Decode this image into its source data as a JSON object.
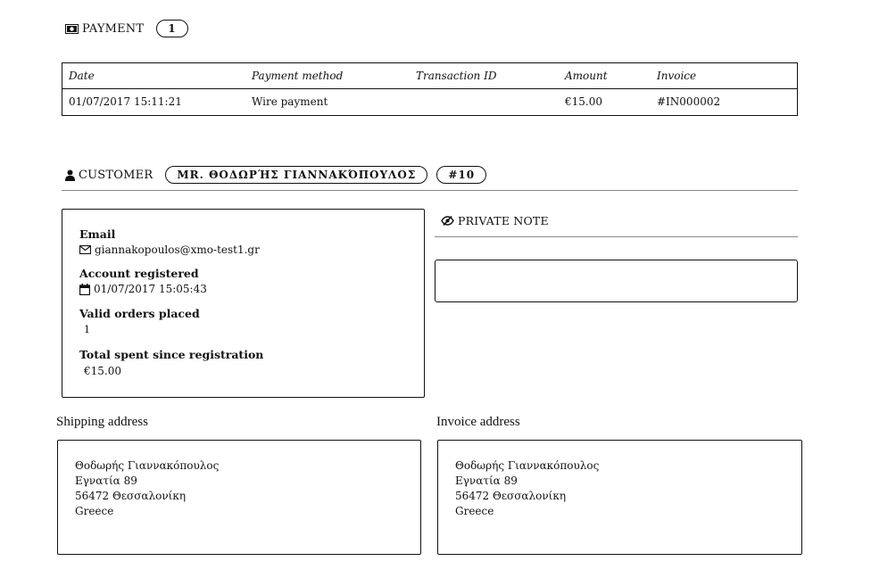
{
  "payment": {
    "title": "PAYMENT",
    "count": "1",
    "columns": [
      "Date",
      "Payment method",
      "Transaction ID",
      "Amount",
      "Invoice"
    ],
    "rows": [
      [
        "01/07/2017 15:11:21",
        "Wire payment",
        "",
        "€15.00",
        "#IN000002"
      ]
    ]
  },
  "customer": {
    "title": "CUSTOMER",
    "name": "MR. ΘΟΔΩΡΉΣ ΓΙΑΝΝΑΚΌΠΟΥΛΟΣ",
    "id": "#10",
    "email_label": "Email",
    "email": "giannakopoulos@xmo-test1.gr",
    "registered_label": "Account registered",
    "registered": "01/07/2017 15:05:43",
    "orders_label": "Valid orders placed",
    "orders": "1",
    "spent_label": "Total spent since registration",
    "spent": "€15.00"
  },
  "private_note": {
    "title": "PRIVATE NOTE",
    "value": ""
  },
  "shipping": {
    "title": "Shipping address",
    "lines": [
      "Θοδωρής Γιαννακόπουλος",
      "Εγνατία 89",
      "56472 Θεσσαλονίκη",
      "Greece"
    ]
  },
  "invoice_address": {
    "title": "Invoice address",
    "lines": [
      "Θοδωρής Γιαννακόπουλος",
      "Εγνατία 89",
      "56472 Θεσσαλονίκη",
      "Greece"
    ]
  },
  "icons": {
    "payment": "money-icon",
    "customer": "user-icon",
    "email": "envelope-icon",
    "calendar": "calendar-icon",
    "private_note": "eye-slash-icon"
  }
}
